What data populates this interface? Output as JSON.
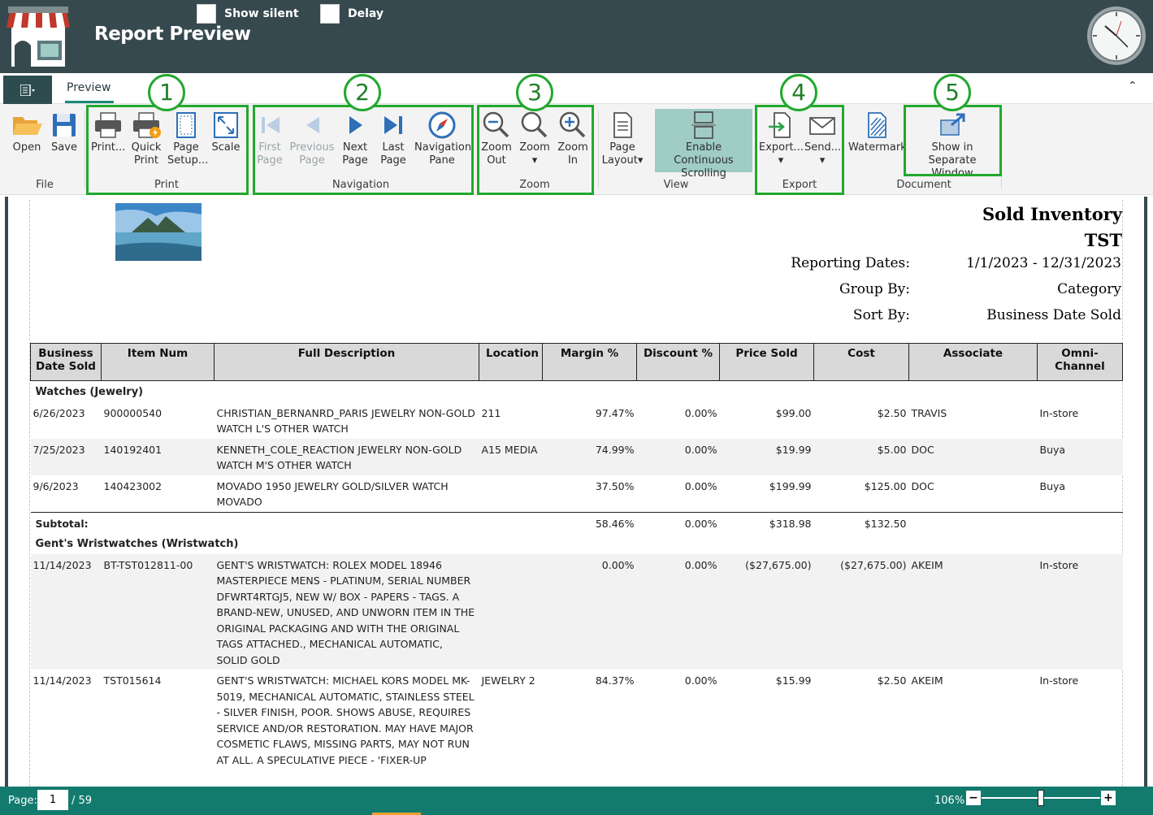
{
  "window": {
    "title": "Report Preview",
    "show_silent_label": "Show silent",
    "delay_label": "Delay"
  },
  "tabs": {
    "preview": "Preview"
  },
  "ribbon": {
    "file": {
      "open": "Open",
      "save": "Save",
      "group": "File"
    },
    "print": {
      "print": "Print...",
      "quick_print_1": "Quick",
      "quick_print_2": "Print",
      "page_setup_1": "Page",
      "page_setup_2": "Setup...",
      "scale": "Scale",
      "group": "Print"
    },
    "navigation": {
      "first_1": "First",
      "first_2": "Page",
      "prev_1": "Previous",
      "prev_2": "Page",
      "next_1": "Next",
      "next_2": "Page",
      "last_1": "Last",
      "last_2": "Page",
      "pane_1": "Navigation",
      "pane_2": "Pane",
      "group": "Navigation"
    },
    "zoom": {
      "out_1": "Zoom",
      "out_2": "Out",
      "zoom": "Zoom",
      "in_1": "Zoom",
      "in_2": "In",
      "group": "Zoom"
    },
    "view": {
      "layout_1": "Page",
      "layout_2": "Layout",
      "cont_1": "Enable Continuous",
      "cont_2": "Scrolling",
      "group": "View"
    },
    "export": {
      "export": "Export...",
      "send": "Send...",
      "group": "Export"
    },
    "document": {
      "watermark": "Watermark",
      "sep_1": "Show in",
      "sep_2": "Separate Window",
      "group": "Document"
    }
  },
  "callouts": [
    "1",
    "2",
    "3",
    "4",
    "5"
  ],
  "report": {
    "title": "Sold Inventory",
    "subtitle": "TST",
    "meta": [
      {
        "label": "Reporting Dates:",
        "value": "1/1/2023 - 12/31/2023"
      },
      {
        "label": "Group By:",
        "value": "Category"
      },
      {
        "label": "Sort By:",
        "value": "Business Date Sold"
      }
    ],
    "columns": [
      "Business Date Sold",
      "Item Num",
      "Full Description",
      "Location",
      "Margin %",
      "Discount %",
      "Price Sold",
      "Cost",
      "Associate",
      "Omni-Channel"
    ],
    "groups": [
      {
        "name": "Watches  (Jewelry)",
        "rows": [
          {
            "date": "6/26/2023",
            "item": "900000540",
            "desc": " CHRISTIAN_BERNANRD_PARIS JEWELRY NON-GOLD WATCH L'S OTHER WATCH",
            "loc": "211",
            "margin": "97.47%",
            "discount": "0.00%",
            "price": "$99.00",
            "cost": "$2.50",
            "assoc": "TRAVIS",
            "omni": "In-store"
          },
          {
            "date": "7/25/2023",
            "item": "140192401",
            "desc": "KENNETH_COLE_REACTION JEWELRY NON-GOLD WATCH M'S OTHER WATCH",
            "loc": "A15 MEDIA",
            "margin": "74.99%",
            "discount": "0.00%",
            "price": "$19.99",
            "cost": "$5.00",
            "assoc": "DOC",
            "omni": "Buya"
          },
          {
            "date": "9/6/2023",
            "item": "140423002",
            "desc": "MOVADO 1950 JEWELRY GOLD/SILVER WATCH MOVADO",
            "loc": "",
            "margin": "37.50%",
            "discount": "0.00%",
            "price": "$199.99",
            "cost": "$125.00",
            "assoc": "DOC",
            "omni": "Buya"
          }
        ],
        "subtotal": {
          "label": "Subtotal:",
          "margin": "58.46%",
          "discount": "0.00%",
          "price": "$318.98",
          "cost": "$132.50"
        }
      },
      {
        "name": "Gent's Wristwatches  (Wristwatch)",
        "rows": [
          {
            "date": "11/14/2023",
            "item": "BT-TST012811-00",
            "desc": "GENT'S WRISTWATCH: ROLEX MODEL 18946 MASTERPIECE MENS - PLATINUM, SERIAL NUMBER DFWRT4RTGJ5, NEW W/ BOX - PAPERS - TAGS. A BRAND-NEW, UNUSED, AND UNWORN ITEM IN THE ORIGINAL PACKAGING AND WITH THE ORIGINAL TAGS ATTACHED., MECHANICAL AUTOMATIC, SOLID GOLD",
            "loc": "",
            "margin": "0.00%",
            "discount": "0.00%",
            "price": "($27,675.00)",
            "cost": "($27,675.00)",
            "assoc": "AKEIM",
            "omni": "In-store"
          },
          {
            "date": "11/14/2023",
            "item": "TST015614",
            "desc": "GENT'S WRISTWATCH: MICHAEL KORS MODEL MK-5019, MECHANICAL AUTOMATIC, STAINLESS STEEL - SILVER FINISH, POOR. SHOWS ABUSE, REQUIRES SERVICE AND/OR RESTORATION. MAY HAVE MAJOR COSMETIC FLAWS, MISSING PARTS, MAY NOT RUN AT ALL. A SPECULATIVE PIECE - 'FIXER-UP",
            "loc": "JEWELRY 2",
            "margin": "84.37%",
            "discount": "0.00%",
            "price": "$15.99",
            "cost": "$2.50",
            "assoc": "AKEIM",
            "omni": "In-store"
          }
        ]
      }
    ]
  },
  "status": {
    "page_label": "Page:",
    "page_value": "1",
    "page_total": "/ 59",
    "zoom": "106%",
    "zoom_minus": "−",
    "zoom_plus": "+"
  },
  "colors": {
    "titlebar": "#36494e",
    "accent": "#137a6e",
    "highlight": "#22a82e"
  }
}
